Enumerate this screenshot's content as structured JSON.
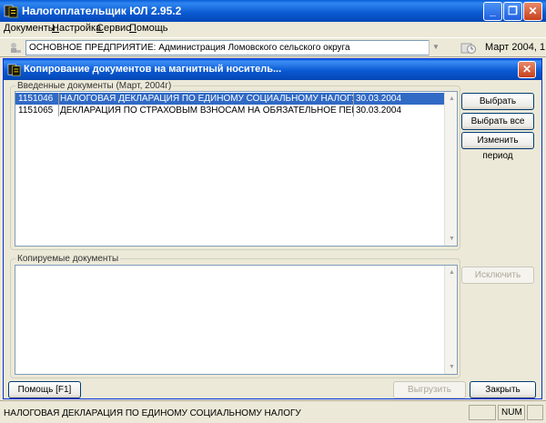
{
  "window": {
    "title": "Налогоплательщик ЮЛ 2.95.2"
  },
  "menu": [
    "Документы",
    "Настройка",
    "Сервис",
    "Помощь"
  ],
  "toolbar": {
    "organization": "ОСНОВНОЕ ПРЕДПРИЯТИЕ: Администрация Ломовского сельского округа",
    "period": "Март 2004, 1"
  },
  "dialog": {
    "title": "Копирование документов на магнитный носитель...",
    "entered_group_label": "Введенные документы (Март, 2004г)",
    "entered_docs": [
      {
        "code": "1151046",
        "name": "НАЛОГОВАЯ ДЕКЛАРАЦИЯ ПО ЕДИНОМУ СОЦИАЛЬНОМУ НАЛОГУ",
        "date": "30.03.2004",
        "selected": true
      },
      {
        "code": "1151065",
        "name": "ДЕКЛАРАЦИЯ ПО СТРАХОВЫМ ВЗНОСАМ НА ОБЯЗАТЕЛЬНОЕ ПЕНСИОННОЕ СТ",
        "date": "30.03.2004",
        "selected": false
      }
    ],
    "copied_group_label": "Копируемые документы",
    "buttons": {
      "select": "Выбрать",
      "select_all": "Выбрать все",
      "change_period": "Изменить период",
      "exclude": "Исключить",
      "help": "Помощь [F1]",
      "export": "Выгрузить",
      "close": "Закрыть"
    }
  },
  "statusbar": {
    "text": "НАЛОГОВАЯ ДЕКЛАРАЦИЯ ПО ЕДИНОМУ СОЦИАЛЬНОМУ НАЛОГУ",
    "num": "NUM"
  },
  "colors": {
    "titlebar": "#0a5fd8",
    "selection": "#316ac5",
    "face": "#ece9d8",
    "close": "#c8401d"
  }
}
